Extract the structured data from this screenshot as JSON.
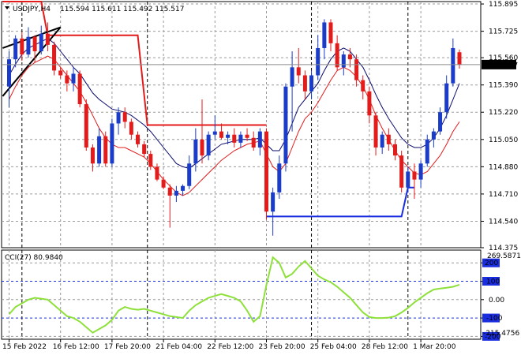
{
  "window_title": "USDJPY,H4",
  "ohlc": {
    "open": "115.594",
    "high": "115.611",
    "low": "115.492",
    "close": "115.517"
  },
  "price_badge": "115.517",
  "cci_label": "CCI(27) 80.9840",
  "cci_badge_max": "269.5871",
  "cci_badge_min": "-215.4756",
  "colors": {
    "bull_candle": "#1a3cc8",
    "bear_candle": "#e31b1b",
    "upper_ma": "#0a0a6e",
    "lower_ma": "#e31b1b",
    "cci_line": "#8ee03a",
    "step_red": "#e31b1b",
    "step_blue": "#1a2ee0",
    "trendline": "#000000",
    "cci_level_band": "#1a2ee0",
    "price_badge_bg": "#000000"
  },
  "chart_data": {
    "type": "candlestick",
    "symbol": "USDJPY",
    "timeframe": "H4",
    "price_ylim": [
      114.375,
      115.91
    ],
    "price_ticks": [
      "115.895",
      "115.725",
      "115.560",
      "115.390",
      "115.220",
      "115.050",
      "114.880",
      "114.710",
      "114.540",
      "114.375"
    ],
    "x_tick_labels": [
      "15 Feb 2022",
      "16 Feb 12:00",
      "17 Feb 20:00",
      "21 Feb 04:00",
      "22 Feb 12:00",
      "23 Feb 20:00",
      "25 Feb 04:00",
      "28 Feb 12:00",
      "1 Mar 20:00"
    ],
    "x_tick_bars": [
      0,
      8,
      16,
      24,
      32,
      40,
      48,
      56,
      64
    ],
    "day_separator_bars": [
      2,
      21.5,
      47,
      62
    ],
    "candles": [
      [
        115.38,
        115.6,
        115.25,
        115.55
      ],
      [
        115.55,
        115.7,
        115.5,
        115.68
      ],
      [
        115.68,
        115.72,
        115.54,
        115.58
      ],
      [
        115.58,
        115.75,
        115.56,
        115.69
      ],
      [
        115.69,
        115.7,
        115.53,
        115.6
      ],
      [
        115.6,
        115.76,
        115.58,
        115.71
      ],
      [
        115.71,
        115.78,
        115.6,
        115.64
      ],
      [
        115.64,
        115.66,
        115.45,
        115.48
      ],
      [
        115.48,
        115.5,
        115.43,
        115.45
      ],
      [
        115.45,
        115.48,
        115.35,
        115.4
      ],
      [
        115.4,
        115.5,
        115.35,
        115.46
      ],
      [
        115.46,
        115.48,
        115.25,
        115.27
      ],
      [
        115.27,
        115.3,
        114.98,
        115.0
      ],
      [
        115.0,
        115.02,
        114.85,
        114.9
      ],
      [
        114.9,
        115.12,
        114.88,
        115.07
      ],
      [
        115.07,
        115.1,
        114.88,
        114.9
      ],
      [
        114.9,
        115.18,
        114.88,
        115.15
      ],
      [
        115.15,
        115.25,
        115.08,
        115.22
      ],
      [
        115.22,
        115.25,
        115.12,
        115.16
      ],
      [
        115.16,
        115.18,
        115.05,
        115.08
      ],
      [
        115.08,
        115.1,
        115.0,
        115.02
      ],
      [
        115.02,
        115.04,
        114.94,
        114.96
      ],
      [
        114.96,
        114.98,
        114.86,
        114.88
      ],
      [
        114.88,
        114.9,
        114.79,
        114.8
      ],
      [
        114.8,
        114.82,
        114.74,
        114.75
      ],
      [
        114.75,
        114.77,
        114.5,
        114.7
      ],
      [
        114.7,
        114.76,
        114.66,
        114.73
      ],
      [
        114.73,
        114.77,
        114.7,
        114.76
      ],
      [
        114.76,
        114.95,
        114.74,
        114.9
      ],
      [
        114.9,
        115.12,
        114.85,
        115.05
      ],
      [
        115.05,
        115.3,
        114.9,
        114.95
      ],
      [
        114.95,
        115.1,
        114.92,
        115.08
      ],
      [
        115.08,
        115.2,
        115.05,
        115.1
      ],
      [
        115.1,
        115.15,
        115.05,
        115.06
      ],
      [
        115.06,
        115.1,
        115.02,
        115.08
      ],
      [
        115.08,
        115.12,
        115.0,
        115.03
      ],
      [
        115.03,
        115.1,
        115.0,
        115.08
      ],
      [
        115.08,
        115.12,
        115.04,
        115.06
      ],
      [
        115.06,
        115.1,
        114.98,
        115.0
      ],
      [
        115.0,
        115.12,
        114.95,
        115.1
      ],
      [
        115.1,
        115.12,
        114.55,
        114.6
      ],
      [
        114.6,
        114.75,
        114.45,
        114.72
      ],
      [
        114.72,
        114.95,
        114.68,
        114.9
      ],
      [
        114.9,
        115.4,
        114.85,
        115.38
      ],
      [
        115.38,
        115.6,
        115.1,
        115.5
      ],
      [
        115.5,
        115.62,
        115.4,
        115.45
      ],
      [
        115.45,
        115.48,
        115.3,
        115.35
      ],
      [
        115.35,
        115.48,
        115.3,
        115.45
      ],
      [
        115.45,
        115.7,
        115.42,
        115.62
      ],
      [
        115.62,
        115.8,
        115.55,
        115.78
      ],
      [
        115.78,
        115.8,
        115.6,
        115.65
      ],
      [
        115.65,
        115.7,
        115.48,
        115.5
      ],
      [
        115.5,
        115.6,
        115.45,
        115.58
      ],
      [
        115.58,
        115.62,
        115.5,
        115.55
      ],
      [
        115.55,
        115.58,
        115.38,
        115.42
      ],
      [
        115.42,
        115.45,
        115.3,
        115.35
      ],
      [
        115.35,
        115.38,
        115.15,
        115.2
      ],
      [
        115.2,
        115.22,
        114.95,
        115.0
      ],
      [
        115.0,
        115.1,
        114.96,
        115.08
      ],
      [
        115.08,
        115.12,
        114.98,
        115.02
      ],
      [
        115.02,
        115.05,
        114.92,
        114.95
      ],
      [
        114.95,
        114.98,
        114.72,
        114.75
      ],
      [
        114.75,
        114.88,
        114.72,
        114.85
      ],
      [
        114.85,
        114.9,
        114.68,
        114.8
      ],
      [
        114.8,
        114.92,
        114.75,
        114.9
      ],
      [
        114.9,
        115.08,
        114.88,
        115.05
      ],
      [
        115.05,
        115.12,
        115.0,
        115.1
      ],
      [
        115.1,
        115.25,
        115.08,
        115.22
      ],
      [
        115.22,
        115.45,
        115.18,
        115.4
      ],
      [
        115.4,
        115.68,
        115.38,
        115.62
      ],
      [
        115.594,
        115.611,
        115.492,
        115.517
      ]
    ],
    "upper_ma": [
      115.45,
      115.52,
      115.58,
      115.62,
      115.64,
      115.66,
      115.68,
      115.65,
      115.6,
      115.55,
      115.5,
      115.46,
      115.4,
      115.34,
      115.3,
      115.27,
      115.24,
      115.23,
      115.22,
      115.2,
      115.17,
      115.14,
      115.1,
      115.05,
      115.0,
      114.95,
      114.9,
      114.88,
      114.87,
      114.9,
      114.93,
      114.96,
      114.99,
      115.02,
      115.03,
      115.04,
      115.05,
      115.05,
      115.05,
      115.06,
      115.02,
      114.98,
      114.98,
      115.05,
      115.15,
      115.25,
      115.3,
      115.35,
      115.4,
      115.48,
      115.55,
      115.6,
      115.62,
      115.6,
      115.55,
      115.5,
      115.42,
      115.33,
      115.25,
      115.18,
      115.12,
      115.06,
      115.02,
      115.0,
      115.0,
      115.02,
      115.06,
      115.12,
      115.2,
      115.3,
      115.4
    ],
    "lower_ma": [
      115.3,
      115.38,
      115.45,
      115.5,
      115.53,
      115.55,
      115.57,
      115.55,
      115.5,
      115.45,
      115.4,
      115.35,
      115.28,
      115.2,
      115.12,
      115.06,
      115.02,
      115.0,
      115.0,
      114.98,
      114.96,
      114.94,
      114.9,
      114.85,
      114.8,
      114.76,
      114.72,
      114.7,
      114.72,
      114.76,
      114.8,
      114.84,
      114.88,
      114.92,
      114.95,
      114.98,
      115.0,
      115.02,
      115.03,
      115.04,
      114.96,
      114.88,
      114.85,
      114.9,
      115.0,
      115.1,
      115.18,
      115.22,
      115.28,
      115.35,
      115.42,
      115.48,
      115.5,
      115.48,
      115.44,
      115.38,
      115.3,
      115.2,
      115.12,
      115.05,
      114.98,
      114.92,
      114.88,
      114.84,
      114.83,
      114.85,
      114.9,
      114.95,
      115.02,
      115.1,
      115.16
    ],
    "step_red": [
      [
        -1,
        115.91
      ],
      [
        5,
        115.91
      ],
      [
        6,
        115.7
      ],
      [
        11,
        115.7
      ],
      [
        13,
        115.7
      ],
      [
        18,
        115.7
      ],
      [
        20,
        115.7
      ],
      [
        21.5,
        115.14
      ],
      [
        29,
        115.14
      ],
      [
        37,
        115.14
      ],
      [
        40,
        115.14
      ]
    ],
    "step_blue": [
      [
        40,
        114.57
      ],
      [
        47,
        114.57
      ],
      [
        54,
        114.57
      ],
      [
        61,
        114.57
      ],
      [
        62,
        114.75
      ],
      [
        63,
        114.75
      ]
    ],
    "trendlines": [
      [
        [
          -1,
          115.32
        ],
        [
          8,
          115.75
        ]
      ],
      [
        [
          -1,
          115.62
        ],
        [
          8,
          115.75
        ]
      ]
    ],
    "cci_ylim": [
      -215.4756,
      269.5871
    ],
    "cci_levels": [
      200,
      100,
      0,
      -100,
      -200
    ],
    "cci_level_labels": [
      "200",
      "100",
      "0.00",
      "-100",
      "-200"
    ],
    "cci": [
      -80,
      -40,
      -20,
      0,
      10,
      5,
      0,
      -30,
      -60,
      -90,
      -100,
      -120,
      -150,
      -180,
      -160,
      -140,
      -110,
      -60,
      -40,
      -50,
      -55,
      -50,
      -60,
      -70,
      -80,
      -90,
      -95,
      -100,
      -60,
      -30,
      -10,
      10,
      20,
      30,
      20,
      10,
      -10,
      -60,
      -120,
      -90,
      80,
      230,
      200,
      120,
      140,
      180,
      210,
      170,
      130,
      110,
      95,
      70,
      40,
      10,
      -30,
      -70,
      -95,
      -100,
      -100,
      -98,
      -90,
      -70,
      -45,
      -15,
      10,
      35,
      55,
      60,
      65,
      70,
      80.984
    ]
  }
}
